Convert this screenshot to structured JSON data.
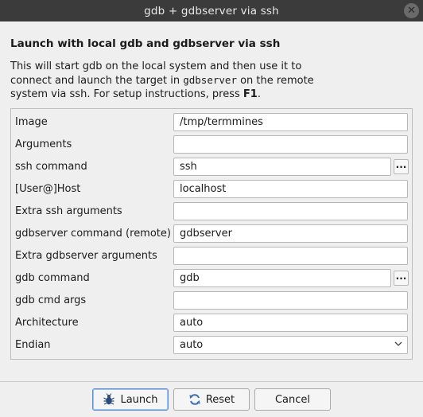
{
  "window": {
    "title": "gdb + gdbserver via ssh",
    "close_glyph": "✕"
  },
  "header": "Launch with local gdb and gdbserver via ssh",
  "description": {
    "part1": "This will start gdb on the local system and then use it to connect and launch the target in ",
    "mono": "gdbserver",
    "part2": " on the remote system via ssh. For setup instructions, press ",
    "key": "F1",
    "part3": "."
  },
  "fields": [
    {
      "label": "Image",
      "value": "/tmp/termmines"
    },
    {
      "label": "Arguments",
      "value": ""
    },
    {
      "label": "ssh command",
      "value": "ssh",
      "browse": "..."
    },
    {
      "label": "[User@]Host",
      "value": "localhost"
    },
    {
      "label": "Extra ssh arguments",
      "value": ""
    },
    {
      "label": "gdbserver command (remote)",
      "value": "gdbserver"
    },
    {
      "label": "Extra gdbserver arguments",
      "value": ""
    },
    {
      "label": "gdb command",
      "value": "gdb",
      "browse": "..."
    },
    {
      "label": "gdb cmd args",
      "value": ""
    },
    {
      "label": "Architecture",
      "value": "auto"
    },
    {
      "label": "Endian",
      "value": "auto",
      "options_selected": "auto"
    }
  ],
  "buttons": {
    "launch": "Launch",
    "reset": "Reset",
    "cancel": "Cancel"
  },
  "icons": {
    "launch": "bug-icon",
    "reset": "refresh-icon",
    "close": "close-icon",
    "dropdown": "chevron-down-icon"
  },
  "colors": {
    "titlebar": "#3b3b3b",
    "dialog_bg": "#efefef",
    "default_button_border": "#5b8fd6"
  }
}
